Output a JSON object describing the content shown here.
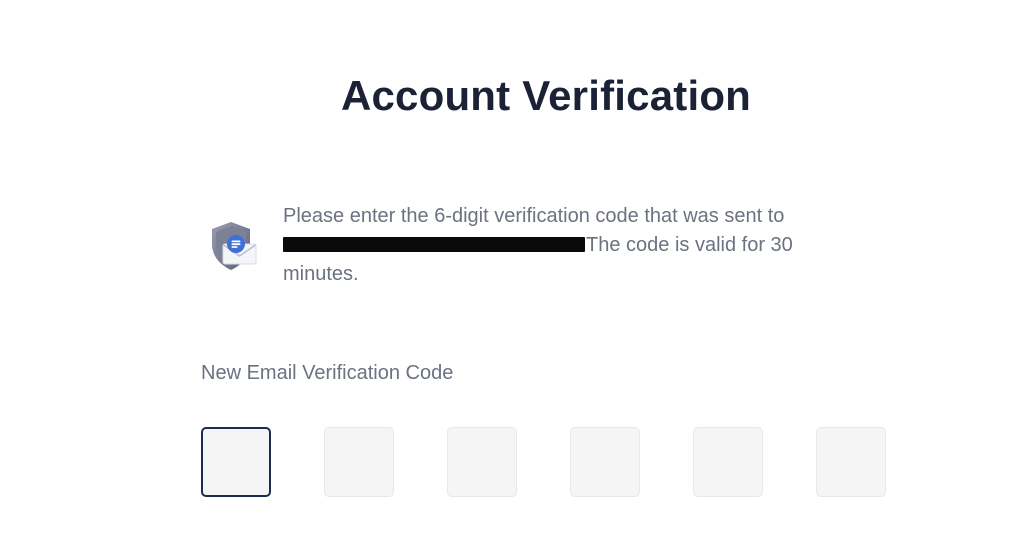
{
  "page": {
    "title": "Account Verification"
  },
  "message": {
    "prefix": "Please enter the 6-digit verification code that was sent to",
    "suffix": "The code is valid for 30 minutes.",
    "icon": "shield-mail-icon"
  },
  "verification": {
    "label": "New Email Verification Code",
    "digits": [
      "",
      "",
      "",
      "",
      "",
      ""
    ],
    "active_index": 0
  },
  "colors": {
    "title": "#1b2235",
    "text": "#6b7280",
    "box_background": "#f5f5f6",
    "active_border": "#1b2d4f",
    "icon_shield": "#6f7389"
  }
}
